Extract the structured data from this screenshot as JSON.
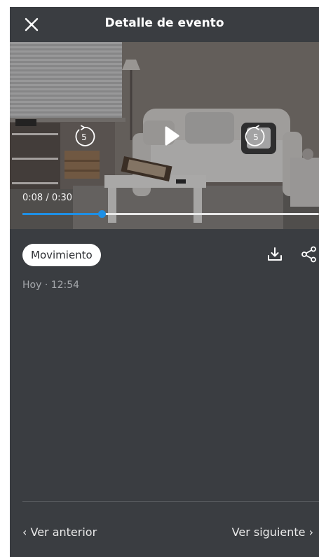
{
  "header": {
    "title": "Detalle de evento",
    "close_icon": "close-icon"
  },
  "video": {
    "current_time": "0:08",
    "duration": "0:30",
    "time_display": "0:08 / 0:30",
    "progress_fraction": 0.2667,
    "rewind_seconds": "5",
    "forward_seconds": "5",
    "accent_color": "#1e90e6"
  },
  "event": {
    "tag": "Movimiento",
    "timestamp": "Hoy · 12:54",
    "download_icon": "download-icon",
    "share_icon": "share-icon"
  },
  "navigation": {
    "previous_label": "Ver anterior",
    "next_label": "Ver siguiente",
    "previous_icon": "‹",
    "next_icon": "›"
  },
  "colors": {
    "background": "#3a3d41",
    "tag_background": "#ffffff",
    "secondary_text": "#a4a7ab"
  }
}
